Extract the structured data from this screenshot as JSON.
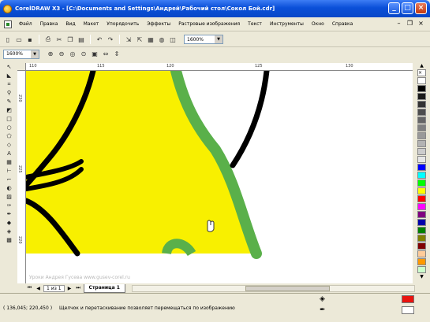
{
  "window": {
    "title": "CorelDRAW X3 - [C:\\Documents and Settings\\Андрей\\Рабочий стол\\Сокол Бой.cdr]"
  },
  "menu": {
    "items": [
      "Файл",
      "Правка",
      "Вид",
      "Макет",
      "Упорядочить",
      "Эффекты",
      "Растровые изображения",
      "Текст",
      "Инструменты",
      "Окно",
      "Справка"
    ]
  },
  "toolbar": {
    "zoom_value": "1600%"
  },
  "property_bar": {
    "zoom_value": "1600%"
  },
  "ruler": {
    "top_ticks": [
      "110",
      "115",
      "120",
      "125",
      "130"
    ],
    "left_ticks": [
      "230",
      "225",
      "220"
    ]
  },
  "canvas": {
    "watermark": "Уроки Андрея Гусева www.gusev-corel.ru",
    "fill_color": "#f8f000",
    "stroke_color": "#5ab04a",
    "outline_color": "#000000"
  },
  "pages": {
    "info": "1 из 1",
    "current_tab": "Страница 1"
  },
  "status": {
    "coords": "( 136,045; 220,450 )",
    "hint": "Щелчок и перетаскивание позволяет перемещаться по изображению"
  },
  "palette": {
    "colors": [
      "#ffffff",
      "#000000",
      "#1a1a1a",
      "#333333",
      "#4d4d4d",
      "#666666",
      "#808080",
      "#999999",
      "#b3b3b3",
      "#cccccc",
      "#e6e6e6",
      "#0000ff",
      "#00ffff",
      "#00ff00",
      "#ffff00",
      "#ff0000",
      "#ff00ff",
      "#800080",
      "#0000aa",
      "#008000",
      "#808000",
      "#800000",
      "#ffcc99",
      "#ff9900",
      "#ccffcc"
    ]
  },
  "current_fill": "#e8130f"
}
